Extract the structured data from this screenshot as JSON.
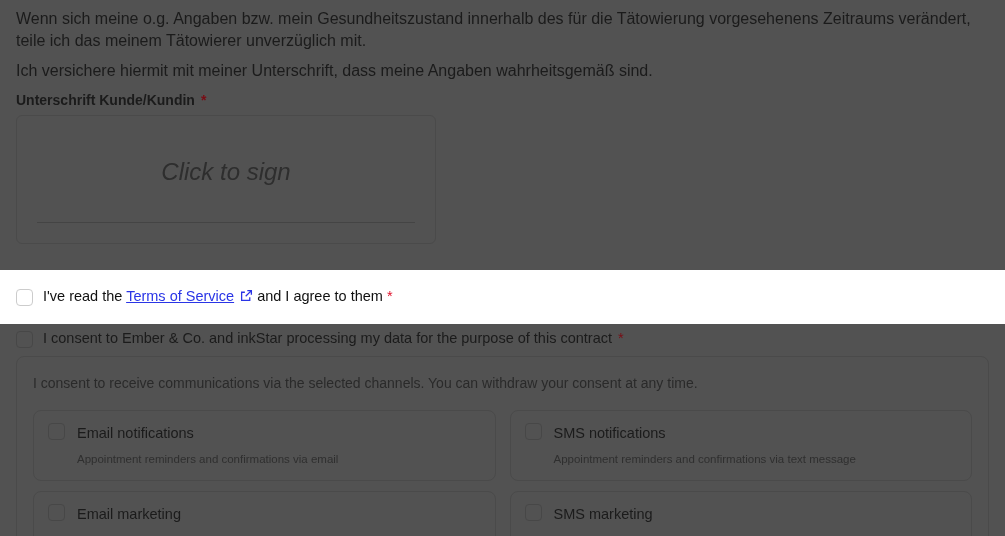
{
  "paragraphs": [
    "Wenn sich meine o.g. Angaben bzw. mein Gesundheitszustand innerhalb des für die Tätowierung vorgesehenens Zeitraums verändert, teile ich das meinem Tätowierer unverzüglich mit.",
    "Ich versichere hiermit mit meiner Unterschrift, dass meine Angaben wahrheitsgemäß sind."
  ],
  "signature": {
    "label": "Unterschrift Kunde/Kundin",
    "required_mark": "*",
    "placeholder": "Click to sign"
  },
  "agreements": [
    {
      "highlighted": true,
      "checked": false,
      "text_before": "I've read the ",
      "link": "Terms of Service",
      "text_after": " and I agree to them",
      "required_mark": "*"
    },
    {
      "highlighted": false,
      "checked": false,
      "text_before": "I consent to Ember & Co. and inkStar processing my data for the purpose of this contract",
      "required_mark": "*"
    }
  ],
  "communications": {
    "intro": "I consent to receive communications via the selected channels. You can withdraw your consent at any time.",
    "channels": [
      {
        "title": "Email notifications",
        "description": "Appointment reminders and confirmations via email",
        "checked": false
      },
      {
        "title": "SMS notifications",
        "description": "Appointment reminders and confirmations via text message",
        "checked": false
      },
      {
        "title": "Email marketing",
        "checked": false
      },
      {
        "title": "SMS marketing",
        "checked": false
      }
    ]
  }
}
